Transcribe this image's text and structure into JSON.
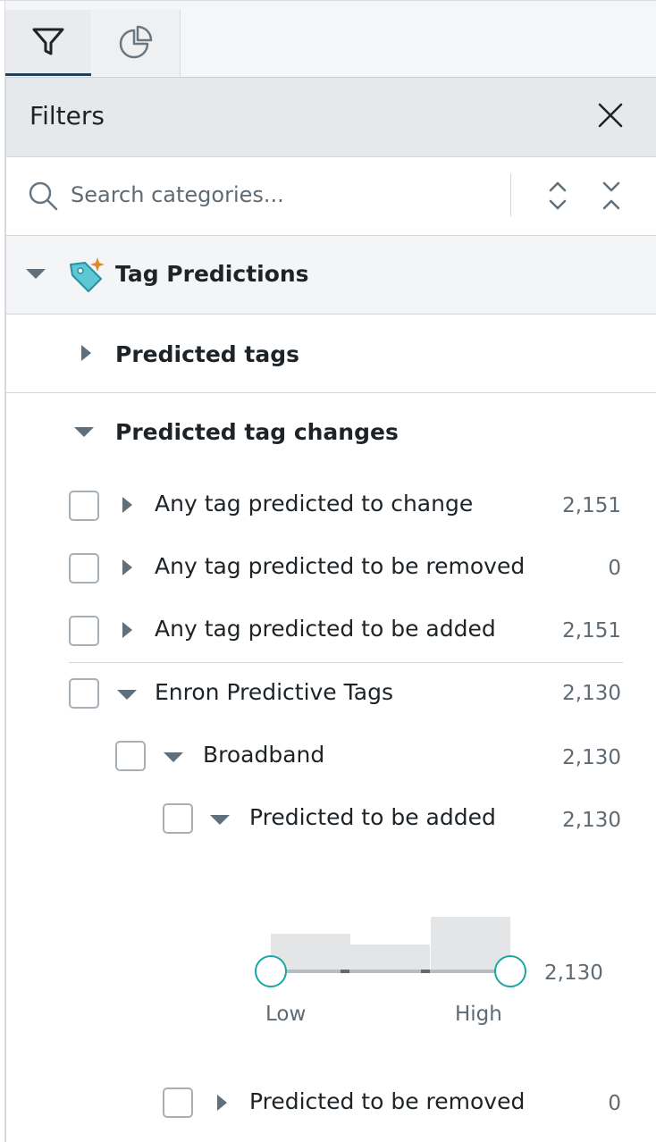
{
  "tabs": [
    {
      "icon": "funnel-icon",
      "active": true
    },
    {
      "icon": "pie-chart-icon",
      "active": false
    }
  ],
  "header": {
    "title": "Filters"
  },
  "search": {
    "placeholder": "Search categories..."
  },
  "section": {
    "title": "Tag Predictions",
    "icon": "tag-sparkle-icon"
  },
  "groups": {
    "predicted_tags": "Predicted tags",
    "predicted_tag_changes": "Predicted tag changes"
  },
  "items": [
    {
      "label": "Any tag predicted to change",
      "count": "2,151"
    },
    {
      "label": "Any tag predicted to be removed",
      "count": "0"
    },
    {
      "label": "Any tag predicted to be added",
      "count": "2,151"
    },
    {
      "label": "Enron Predictive Tags",
      "count": "2,130"
    },
    {
      "label": "Broadband",
      "count": "2,130"
    },
    {
      "label": "Predicted to be added",
      "count": "2,130"
    },
    {
      "label": "Predicted to be removed",
      "count": "0"
    }
  ],
  "slider": {
    "count": "2,130",
    "low_label": "Low",
    "high_label": "High",
    "histogram": [
      0.5,
      0.35,
      0.74
    ],
    "range": [
      0,
      1
    ]
  },
  "colors": {
    "accent": "#1aa7a0",
    "tag_icon": "#5bc8d4",
    "sparkle": "#e0892a"
  }
}
